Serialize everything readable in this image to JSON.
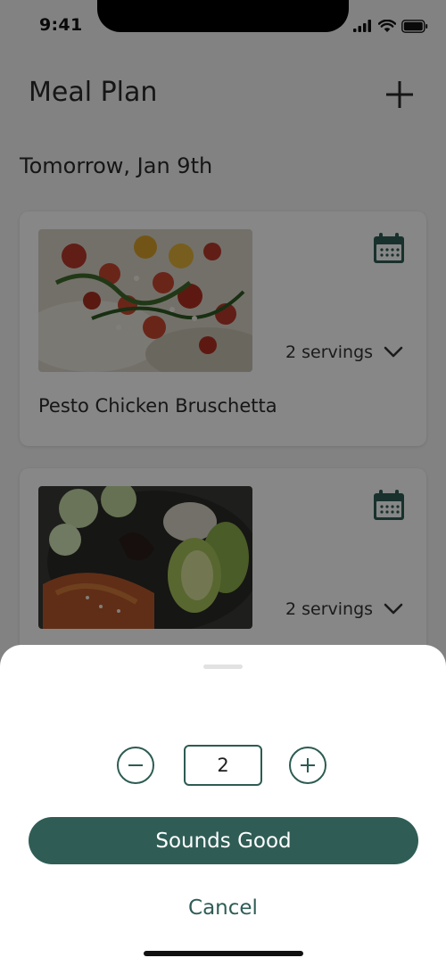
{
  "status_bar": {
    "time": "9:41",
    "icons": [
      "signal-icon",
      "wifi-icon",
      "battery-icon"
    ]
  },
  "header": {
    "title": "Meal Plan",
    "add_icon": "plus-icon"
  },
  "section": {
    "date_label": "Tomorrow, Jan 9th"
  },
  "meals": [
    {
      "name": "Pesto Chicken Bruschetta",
      "servings_label": "2 servings",
      "calendar_icon": "calendar-icon",
      "dropdown_icon": "chevron-down-icon"
    },
    {
      "name": "",
      "servings_label": "2 servings",
      "calendar_icon": "calendar-icon",
      "dropdown_icon": "chevron-down-icon"
    }
  ],
  "sheet": {
    "quantity": "2",
    "minus_icon": "minus-icon",
    "plus_icon": "plus-icon",
    "confirm_label": "Sounds Good",
    "cancel_label": "Cancel"
  },
  "colors": {
    "primary": "#2f5d56",
    "overlay": "rgba(0,0,0,0.47)",
    "background": "#f6f6f6",
    "card": "#ffffff"
  }
}
